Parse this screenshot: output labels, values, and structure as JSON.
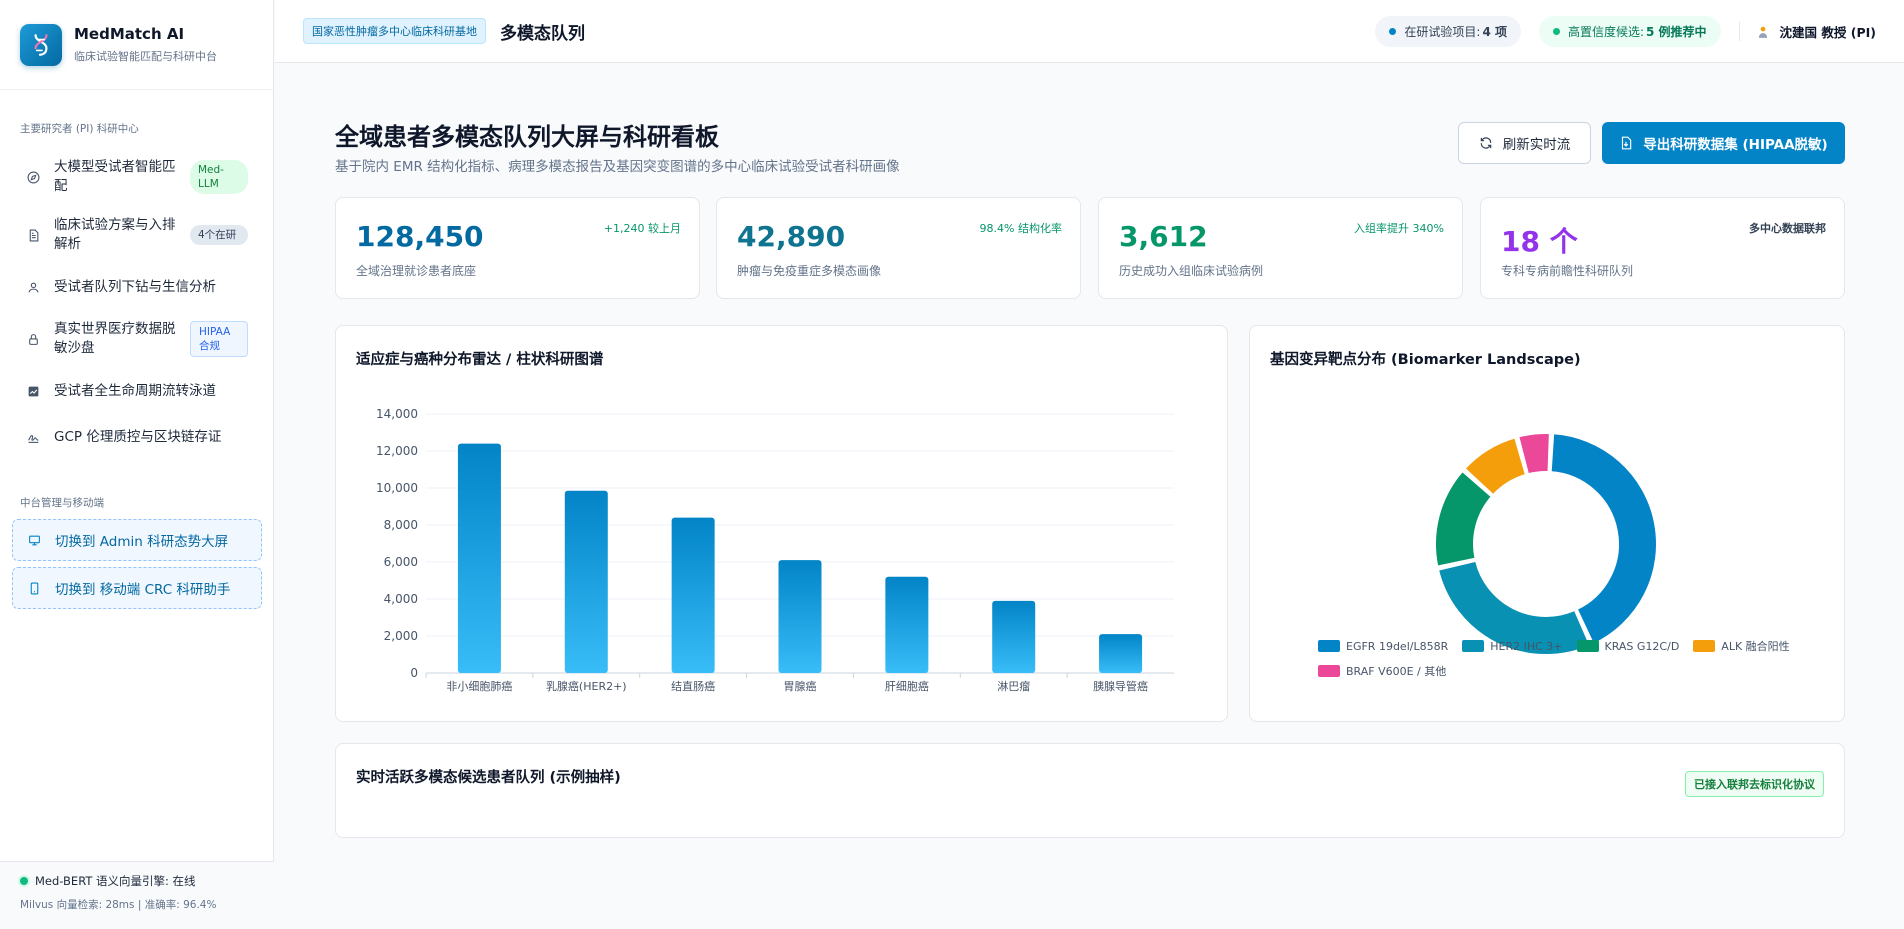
{
  "brand": {
    "name": "MedMatch AI",
    "subtitle": "临床试验智能匹配与科研中台"
  },
  "sidebar": {
    "section1_title": "主要研究者 (PI) 科研中心",
    "items": [
      {
        "label": "大模型受试者智能匹配",
        "badge": "Med-LLM",
        "icon": "compass-icon"
      },
      {
        "label": "临床试验方案与入排解析",
        "badge": "4个在研",
        "icon": "document-icon"
      },
      {
        "label": "受试者队列下钻与生信分析",
        "icon": "user-icon"
      },
      {
        "label": "真实世界医疗数据脱敏沙盘",
        "badge": "HIPAA合规",
        "icon": "lock-icon"
      },
      {
        "label": "受试者全生命周期流转泳道",
        "icon": "chart-icon"
      },
      {
        "label": "GCP 伦理质控与区块链存证",
        "icon": "signature-icon"
      }
    ],
    "section2_title": "中台管理与移动端",
    "switch_admin": "切换到 Admin 科研态势大屏",
    "switch_mobile": "切换到 移动端 CRC 科研助手",
    "footer_status": "Med-BERT 语义向量引擎: 在线",
    "footer_metrics": "Milvus 向量检索: 28ms | 准确率: 96.4%"
  },
  "header": {
    "tag": "国家恶性肿瘤多中心临床科研基地",
    "title": "多模态队列",
    "trials_label": "在研试验项目:",
    "trials_value": "4 项",
    "candidates_label": "高置信度候选:",
    "candidates_value": "5 例推荐中",
    "user": "沈建国 教授 (PI)"
  },
  "main": {
    "title": "全域患者多模态队列大屏与科研看板",
    "subtitle": "基于院内 EMR 结构化指标、病理多模态报告及基因突变图谱的多中心临床试验受试者科研画像",
    "refresh_label": "刷新实时流",
    "export_label": "导出科研数据集 (HIPAA脱敏)"
  },
  "stats": [
    {
      "value": "128,450",
      "label": "全域治理就诊患者底座",
      "trend": "+1,240 较上月"
    },
    {
      "value": "42,890",
      "label": "肿瘤与免疫重症多模态画像",
      "trend": "98.4% 结构化率"
    },
    {
      "value": "3,612",
      "label": "历史成功入组临床试验病例",
      "trend": "入组率提升 340%"
    },
    {
      "value": "18 个",
      "label": "专科专病前瞻性科研队列",
      "trend": "多中心数据联邦"
    }
  ],
  "bar_card": {
    "title": "适应症与癌种分布雷达 / 柱状科研图谱"
  },
  "pie_card": {
    "title": "基因变异靶点分布 (Biomarker Landscape)"
  },
  "cohort_card": {
    "title": "实时活跃多模态候选患者队列 (示例抽样)",
    "tag": "已接入联邦去标识化协议"
  },
  "colors": {
    "accent": "#0284c7",
    "success": "#10b981",
    "purple": "#9333ea"
  },
  "chart_data": [
    {
      "type": "bar",
      "title": "适应症与癌种分布雷达 / 柱状科研图谱",
      "categories": [
        "非小细胞肺癌",
        "乳腺癌(HER2+)",
        "结直肠癌",
        "胃腺癌",
        "肝细胞癌",
        "淋巴瘤",
        "胰腺导管癌"
      ],
      "values": [
        12400,
        9850,
        8400,
        6100,
        5200,
        3900,
        2100
      ],
      "ylim": [
        0,
        14000
      ],
      "yticks": [
        "0",
        "2,000",
        "4,000",
        "6,000",
        "8,000",
        "10,000",
        "12,000",
        "14,000"
      ],
      "grid": true
    },
    {
      "type": "pie",
      "title": "基因变异靶点分布 (Biomarker Landscape)",
      "labels": [
        "EGFR 19del/L858R",
        "HER2 IHC 3+",
        "KRAS G12C/D",
        "ALK 融合阳性",
        "BRAF V600E / 其他"
      ],
      "values": [
        42,
        28,
        15,
        9,
        5
      ],
      "colors": [
        "#0284c7",
        "#0891b2",
        "#059669",
        "#f59e0b",
        "#ec4899"
      ],
      "donut": true,
      "legend": "bottom"
    }
  ]
}
